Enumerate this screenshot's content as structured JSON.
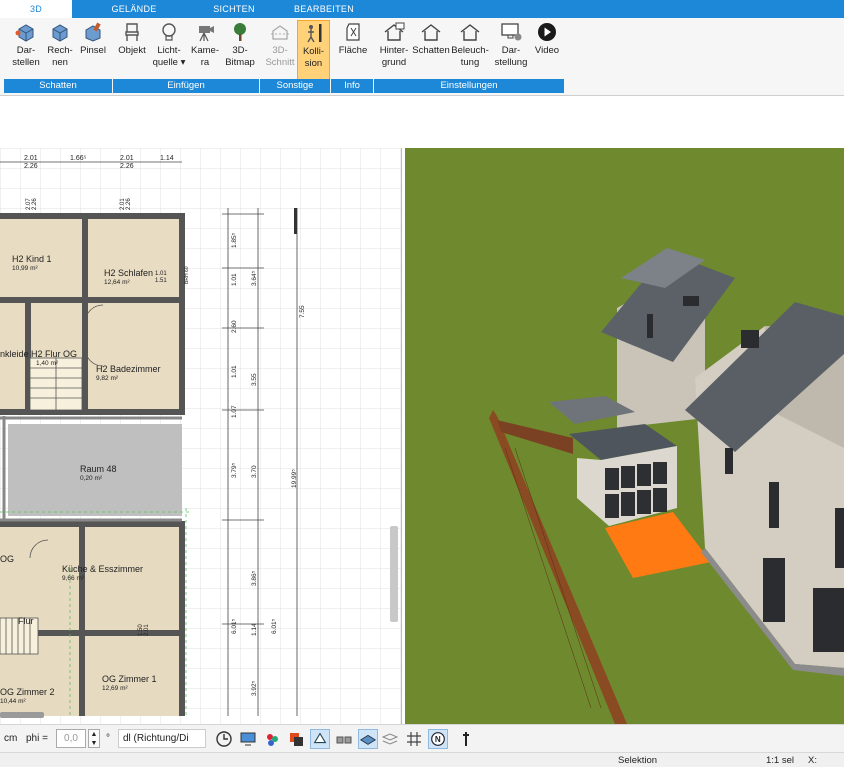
{
  "tabs": [
    {
      "label": "3D",
      "active": true
    },
    {
      "label": "GELÄNDE"
    },
    {
      "label": "SICHTEN"
    },
    {
      "label": "BEARBEITEN"
    }
  ],
  "ribbon": {
    "buttons": [
      {
        "label": "Dar-\nstellen",
        "icon": "cube-render-icon"
      },
      {
        "label": "Rech-\nnen",
        "icon": "cube-calc-icon"
      },
      {
        "label": "Pinsel",
        "icon": "brush-cube-icon"
      },
      {
        "label": "Objekt",
        "icon": "chair-icon"
      },
      {
        "label": "Licht-\nquelle ▾",
        "icon": "bulb-icon"
      },
      {
        "label": "Kame-\nra",
        "icon": "camera-icon"
      },
      {
        "label": "3D-\nBitmap",
        "icon": "tree-icon"
      },
      {
        "label": "3D-\nSchnitt",
        "icon": "section-icon",
        "disabled": true
      },
      {
        "label": "Kolli-\nsion",
        "icon": "collision-icon",
        "active": true
      },
      {
        "label": "Fläche",
        "icon": "area-icon"
      },
      {
        "label": "Hinter-\ngrund",
        "icon": "house-bg-icon"
      },
      {
        "label": "Schatten",
        "icon": "house-shadow-icon"
      },
      {
        "label": "Beleuch-\ntung",
        "icon": "house-light-icon"
      },
      {
        "label": "Dar-\nstellung",
        "icon": "monitor-gear-icon"
      },
      {
        "label": "Video",
        "icon": "play-icon"
      }
    ],
    "groups": [
      "Schatten",
      "Einfügen",
      "Sonstige",
      "Info",
      "Einstellungen"
    ]
  },
  "plan": {
    "rooms": [
      {
        "name": "H2 Kind 1",
        "area": "10,99 m²"
      },
      {
        "name": "H2 Schlafen",
        "area": "12,64 m²"
      },
      {
        "name": "nkleide H2 Flur OG",
        "area": "1,40 m²"
      },
      {
        "name": "H2 Badezimmer",
        "area": "9,82 m²"
      },
      {
        "name": "Raum 48",
        "area": "0,20 m²"
      },
      {
        "name": "Küche & Esszimmer",
        "area": "9,66 m²"
      },
      {
        "name": "Flur",
        "area": ""
      },
      {
        "name": "OG Zimmer 2",
        "area": "10,44 m²"
      },
      {
        "name": "OG Zimmer 1",
        "area": "12,69 m²"
      },
      {
        "name": "OG",
        "area": ""
      }
    ],
    "dims_top": [
      "2.01",
      "1.66⁵",
      "2.01",
      "1.14",
      "2.26",
      "2.26"
    ],
    "dims_vertical": [
      "1.85⁵",
      "1.01",
      "3.64⁵",
      "2.60",
      "1.01",
      "3.55",
      "7.55",
      "3.79⁵",
      "3.70",
      "19.99⁵",
      "3.86⁵",
      "6.01⁵",
      "6.01⁵",
      "3.92⁵",
      "1.07",
      "1.14"
    ],
    "small_labels": [
      "2.07",
      "2.26",
      "2.01",
      "2.26",
      "1.01",
      "1.51",
      "BRH 60",
      "1.50",
      "2.01"
    ]
  },
  "toolbar": {
    "unit": "cm",
    "phi_label": "phi =",
    "phi_value": "0,0",
    "degree": "°",
    "mode": "dl (Richtung/Di",
    "icons": [
      "clock-icon",
      "screen-icon",
      "palette-icon",
      "layers-icon",
      "pointer-icon",
      "walls-icon",
      "plane-icon",
      "stack-icon",
      "grid-icon",
      "north-icon",
      "pin-icon"
    ]
  },
  "status": {
    "mode": "Selektion",
    "scale": "1:1 sel",
    "x_label": "X:"
  },
  "colors": {
    "accent": "#1e88d8",
    "active_button": "#ffd27a",
    "grass": "#6f8a2e",
    "terrace": "#ff7a12"
  }
}
